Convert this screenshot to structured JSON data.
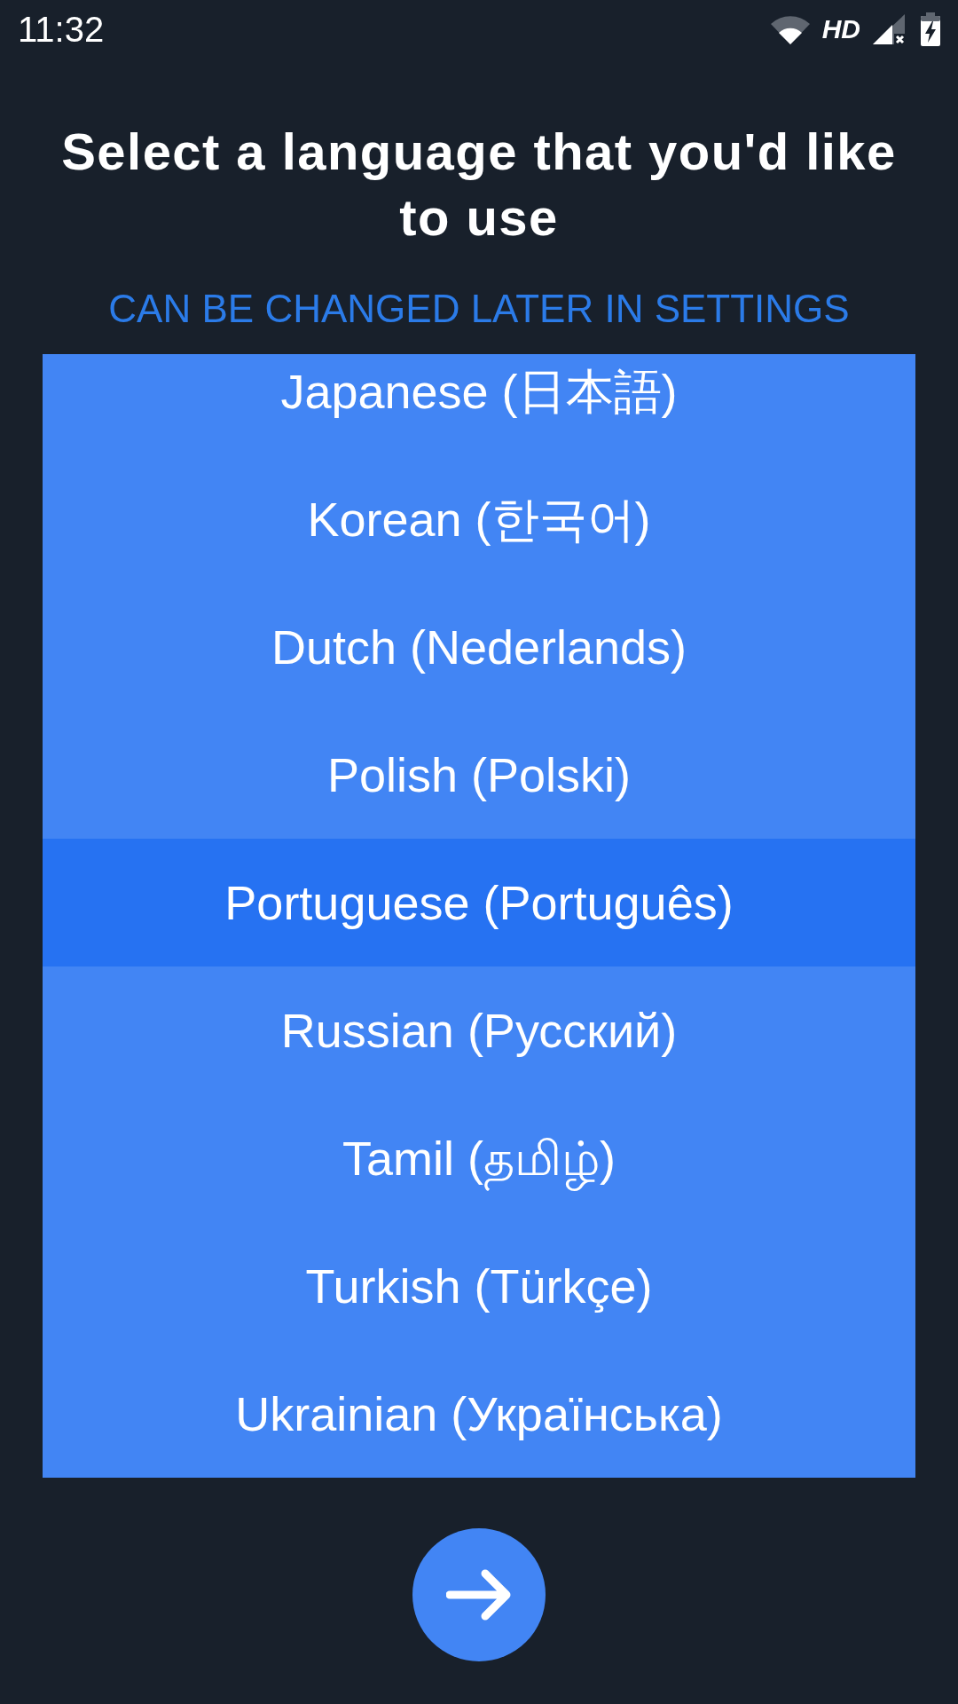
{
  "status_bar": {
    "time": "11:32",
    "network_type": "HD"
  },
  "title": "Select a language that you'd like to use",
  "subtitle": "CAN BE CHANGED LATER IN SETTINGS",
  "languages": [
    {
      "label": "Japanese (日本語)",
      "selected": false
    },
    {
      "label": "Korean (한국어)",
      "selected": false
    },
    {
      "label": "Dutch (Nederlands)",
      "selected": false
    },
    {
      "label": "Polish (Polski)",
      "selected": false
    },
    {
      "label": "Portuguese (Português)",
      "selected": true
    },
    {
      "label": "Russian (Русский)",
      "selected": false
    },
    {
      "label": "Tamil (தமிழ்)",
      "selected": false
    },
    {
      "label": "Turkish (Türkçe)",
      "selected": false
    },
    {
      "label": "Ukrainian (Українська)",
      "selected": false
    }
  ]
}
